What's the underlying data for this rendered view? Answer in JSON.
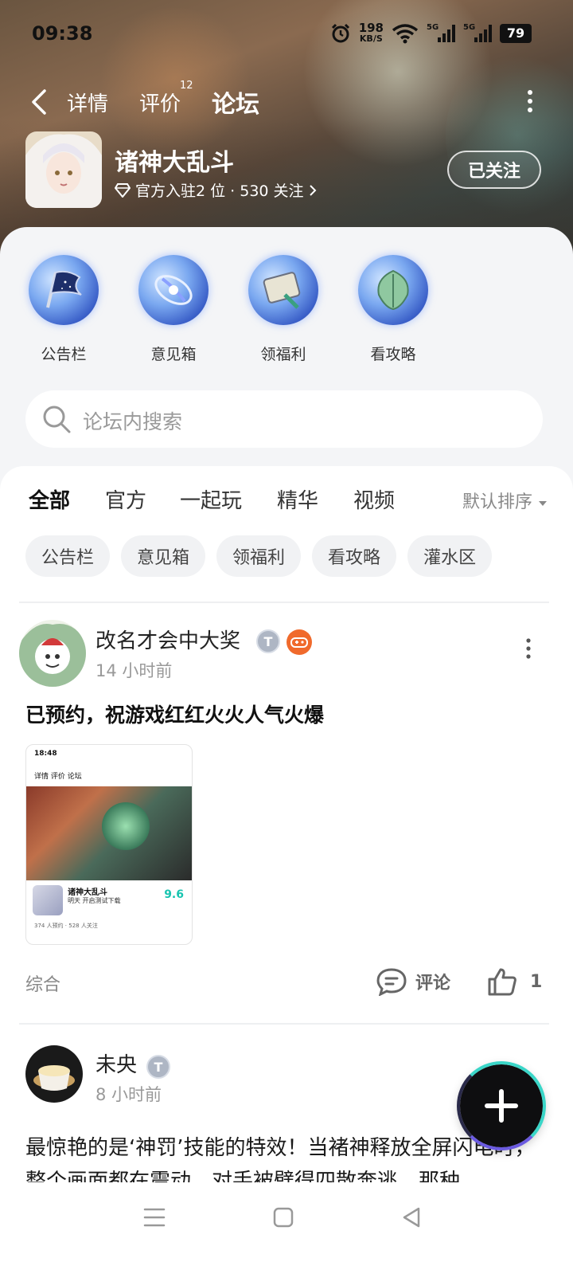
{
  "status_bar": {
    "time": "09:38",
    "net_speed_value": "198",
    "net_speed_unit": "KB/S",
    "signal_1": "5G",
    "signal_2": "5G",
    "battery": "79"
  },
  "top_nav": {
    "tabs": [
      {
        "label": "详情"
      },
      {
        "label": "评价",
        "badge": "12"
      },
      {
        "label": "论坛",
        "active": true
      }
    ]
  },
  "game": {
    "name": "诸神大乱斗",
    "meta": "官方入驻2 位 · 530 关注",
    "follow_label": "已关注"
  },
  "shortcuts": [
    {
      "label": "公告栏",
      "icon": "flag-icon"
    },
    {
      "label": "意见箱",
      "icon": "galaxy-icon"
    },
    {
      "label": "领福利",
      "icon": "scroll-icon"
    },
    {
      "label": "看攻略",
      "icon": "leaf-icon"
    }
  ],
  "search": {
    "placeholder": "论坛内搜索"
  },
  "filter_tabs": {
    "tabs": [
      "全部",
      "官方",
      "一起玩",
      "精华",
      "视频"
    ],
    "active": "全部",
    "sort_label": "默认排序"
  },
  "chips": [
    "公告栏",
    "意见箱",
    "领福利",
    "看攻略",
    "灌水区"
  ],
  "posts": [
    {
      "author": "改名才会中大奖",
      "level_badge": "T",
      "time": "14 小时前",
      "title": "已预约，祝游戏红红火火人气火爆",
      "thumb": {
        "status_time": "18:48",
        "nav": "详情   评价   论坛",
        "name": "诸神大乱斗",
        "sub": "明天 开启测试下载",
        "score": "9.6",
        "foot": "374 人预约 · 528 人关注"
      },
      "category": "综合",
      "comment_label": "评论",
      "like_count": "1"
    },
    {
      "author": "未央",
      "level_badge": "T",
      "time": "8 小时前",
      "text": "最惊艳的是‘神罚’技能的特效！当褚神释放全屏闪电时，整个画面都在震动，对手被劈得四散奔逃，那种"
    }
  ],
  "colors": {
    "accent": "#18d4c0",
    "fab_ring_teal": "#3ad6c8",
    "fab_ring_purple": "#6a5ae0",
    "game_badge": "#f06a2c"
  }
}
